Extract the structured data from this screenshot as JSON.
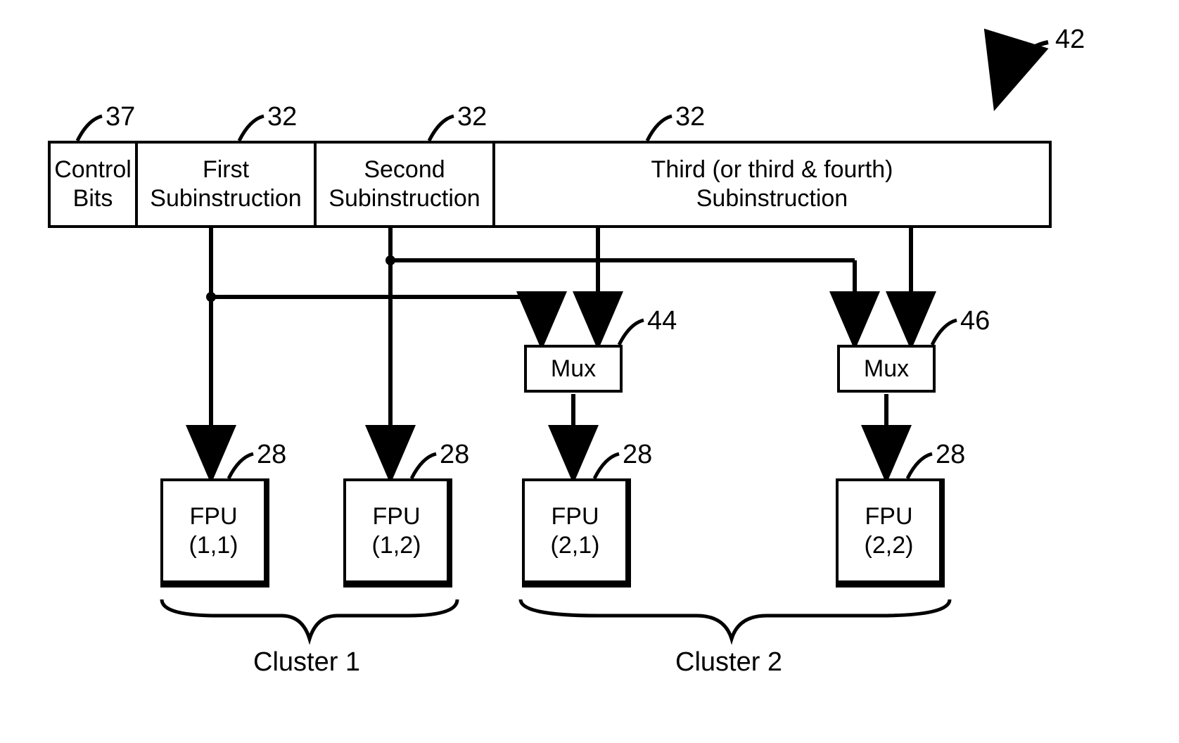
{
  "diagram_ref": "42",
  "instruction_row": {
    "control": {
      "label_line1": "Control",
      "label_line2": "Bits",
      "ref": "37"
    },
    "first": {
      "label_line1": "First",
      "label_line2": "Subinstruction",
      "ref": "32"
    },
    "second": {
      "label_line1": "Second",
      "label_line2": "Subinstruction",
      "ref": "32"
    },
    "third": {
      "label_line1": "Third (or third & fourth)",
      "label_line2": "Subinstruction",
      "ref": "32"
    }
  },
  "mux": {
    "left": {
      "label": "Mux",
      "ref": "44"
    },
    "right": {
      "label": "Mux",
      "ref": "46"
    }
  },
  "fpu": {
    "f11": {
      "label": "FPU",
      "coord": "(1,1)",
      "ref": "28"
    },
    "f12": {
      "label": "FPU",
      "coord": "(1,2)",
      "ref": "28"
    },
    "f21": {
      "label": "FPU",
      "coord": "(2,1)",
      "ref": "28"
    },
    "f22": {
      "label": "FPU",
      "coord": "(2,2)",
      "ref": "28"
    }
  },
  "clusters": {
    "c1": "Cluster 1",
    "c2": "Cluster 2"
  }
}
